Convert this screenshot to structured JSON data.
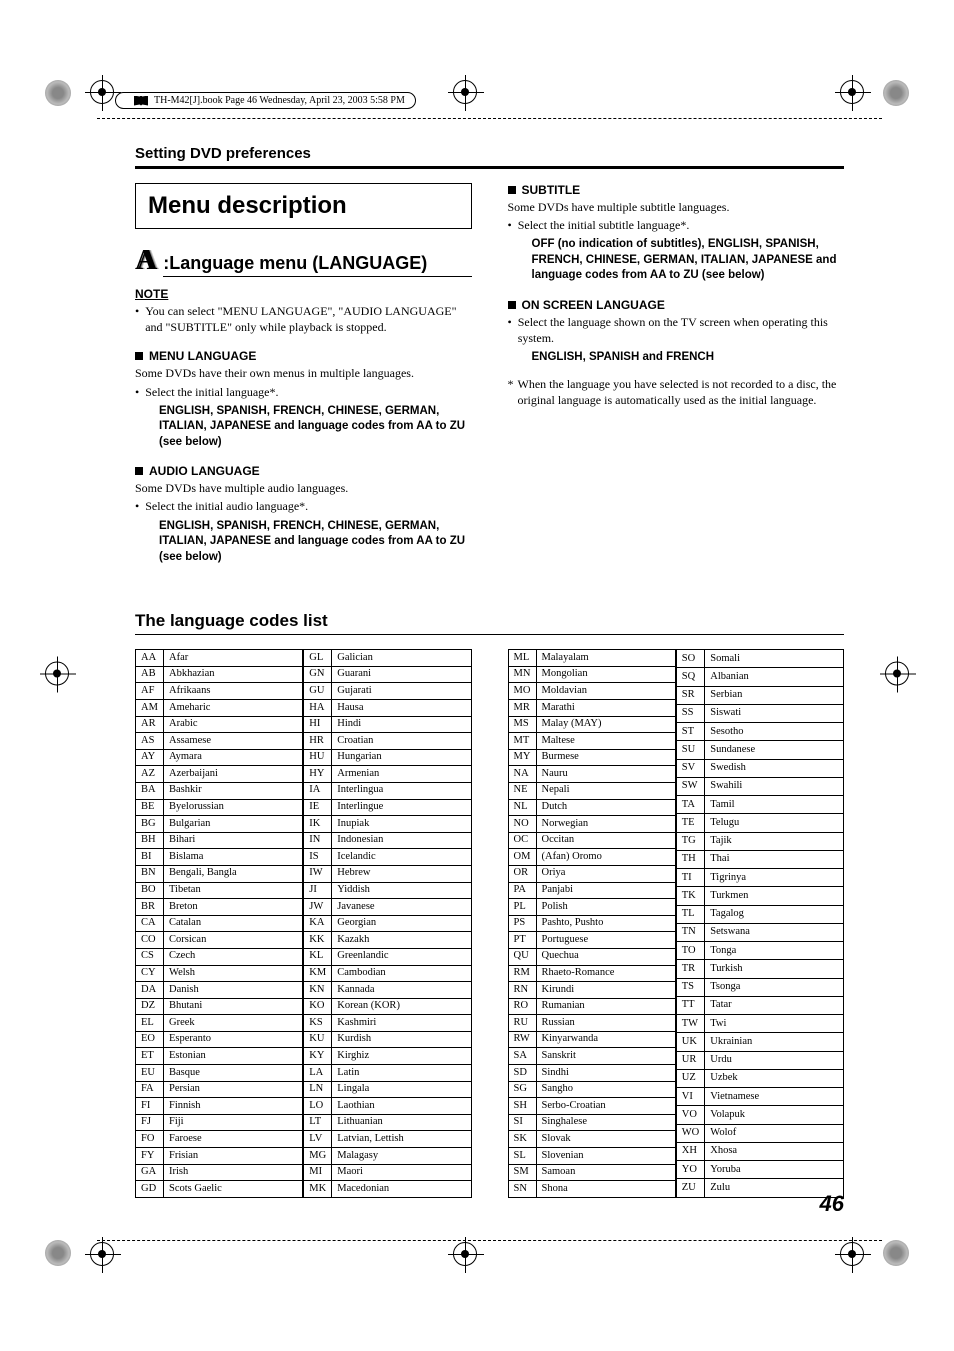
{
  "book_header": "TH-M42[J].book  Page 46  Wednesday, April 23, 2003  5:58 PM",
  "section_header": "Setting DVD preferences",
  "menu_title": "Menu description",
  "language_icon_prefix": ":",
  "language_menu_heading": "Language menu (LANGUAGE)",
  "note_label": "NOTE",
  "note_text": "You can select \"MENU LANGUAGE\", \"AUDIO LANGUAGE\" and \"SUBTITLE\" only while playback is stopped.",
  "sections": {
    "menu_language": {
      "title": "MENU LANGUAGE",
      "intro": "Some DVDs have their own menus in multiple languages.",
      "bullet": "Select the initial language*.",
      "options": "ENGLISH, SPANISH, FRENCH, CHINESE, GERMAN, ITALIAN, JAPANESE and language codes from AA to ZU (see below)"
    },
    "audio_language": {
      "title": "AUDIO LANGUAGE",
      "intro": "Some DVDs have multiple audio languages.",
      "bullet": "Select the initial audio language*.",
      "options": "ENGLISH, SPANISH, FRENCH, CHINESE, GERMAN, ITALIAN, JAPANESE and language codes from AA to ZU (see below)"
    },
    "subtitle": {
      "title": "SUBTITLE",
      "intro": "Some DVDs have multiple subtitle languages.",
      "bullet": "Select the initial subtitle language*.",
      "options": "OFF (no indication of subtitles), ENGLISH, SPANISH, FRENCH, CHINESE, GERMAN, ITALIAN, JAPANESE and language codes from AA to ZU (see below)"
    },
    "on_screen": {
      "title": "ON SCREEN LANGUAGE",
      "bullet": "Select the language shown on the TV screen when operating this system.",
      "options": "ENGLISH, SPANISH and FRENCH"
    }
  },
  "footnote": "When the language you have selected is not recorded to a disc, the original language is automatically used as the initial language.",
  "table_heading": "The language codes list",
  "codes": {
    "col1a": [
      [
        "AA",
        "Afar"
      ],
      [
        "AB",
        "Abkhazian"
      ],
      [
        "AF",
        "Afrikaans"
      ],
      [
        "AM",
        "Ameharic"
      ],
      [
        "AR",
        "Arabic"
      ],
      [
        "AS",
        "Assamese"
      ],
      [
        "AY",
        "Aymara"
      ],
      [
        "AZ",
        "Azerbaijani"
      ],
      [
        "BA",
        "Bashkir"
      ],
      [
        "BE",
        "Byelorussian"
      ],
      [
        "BG",
        "Bulgarian"
      ],
      [
        "BH",
        "Bihari"
      ],
      [
        "BI",
        "Bislama"
      ],
      [
        "BN",
        "Bengali, Bangla"
      ],
      [
        "BO",
        "Tibetan"
      ],
      [
        "BR",
        "Breton"
      ],
      [
        "CA",
        "Catalan"
      ],
      [
        "CO",
        "Corsican"
      ],
      [
        "CS",
        "Czech"
      ],
      [
        "CY",
        "Welsh"
      ],
      [
        "DA",
        "Danish"
      ],
      [
        "DZ",
        "Bhutani"
      ],
      [
        "EL",
        "Greek"
      ],
      [
        "EO",
        "Esperanto"
      ],
      [
        "ET",
        "Estonian"
      ],
      [
        "EU",
        "Basque"
      ],
      [
        "FA",
        "Persian"
      ],
      [
        "FI",
        "Finnish"
      ],
      [
        "FJ",
        "Fiji"
      ],
      [
        "FO",
        "Faroese"
      ],
      [
        "FY",
        "Frisian"
      ],
      [
        "GA",
        "Irish"
      ],
      [
        "GD",
        "Scots Gaelic"
      ]
    ],
    "col1b": [
      [
        "GL",
        "Galician"
      ],
      [
        "GN",
        "Guarani"
      ],
      [
        "GU",
        "Gujarati"
      ],
      [
        "HA",
        "Hausa"
      ],
      [
        "HI",
        "Hindi"
      ],
      [
        "HR",
        "Croatian"
      ],
      [
        "HU",
        "Hungarian"
      ],
      [
        "HY",
        "Armenian"
      ],
      [
        "IA",
        "Interlingua"
      ],
      [
        "IE",
        "Interlingue"
      ],
      [
        "IK",
        "Inupiak"
      ],
      [
        "IN",
        "Indonesian"
      ],
      [
        "IS",
        "Icelandic"
      ],
      [
        "IW",
        "Hebrew"
      ],
      [
        "JI",
        "Yiddish"
      ],
      [
        "JW",
        "Javanese"
      ],
      [
        "KA",
        "Georgian"
      ],
      [
        "KK",
        "Kazakh"
      ],
      [
        "KL",
        "Greenlandic"
      ],
      [
        "KM",
        "Cambodian"
      ],
      [
        "KN",
        "Kannada"
      ],
      [
        "KO",
        "Korean (KOR)"
      ],
      [
        "KS",
        "Kashmiri"
      ],
      [
        "KU",
        "Kurdish"
      ],
      [
        "KY",
        "Kirghiz"
      ],
      [
        "LA",
        "Latin"
      ],
      [
        "LN",
        "Lingala"
      ],
      [
        "LO",
        "Laothian"
      ],
      [
        "LT",
        "Lithuanian"
      ],
      [
        "LV",
        "Latvian, Lettish"
      ],
      [
        "MG",
        "Malagasy"
      ],
      [
        "MI",
        "Maori"
      ],
      [
        "MK",
        "Macedonian"
      ]
    ],
    "col2a": [
      [
        "ML",
        "Malayalam"
      ],
      [
        "MN",
        "Mongolian"
      ],
      [
        "MO",
        "Moldavian"
      ],
      [
        "MR",
        "Marathi"
      ],
      [
        "MS",
        "Malay (MAY)"
      ],
      [
        "MT",
        "Maltese"
      ],
      [
        "MY",
        "Burmese"
      ],
      [
        "NA",
        "Nauru"
      ],
      [
        "NE",
        "Nepali"
      ],
      [
        "NL",
        "Dutch"
      ],
      [
        "NO",
        "Norwegian"
      ],
      [
        "OC",
        "Occitan"
      ],
      [
        "OM",
        "(Afan) Oromo"
      ],
      [
        "OR",
        "Oriya"
      ],
      [
        "PA",
        "Panjabi"
      ],
      [
        "PL",
        "Polish"
      ],
      [
        "PS",
        "Pashto, Pushto"
      ],
      [
        "PT",
        "Portuguese"
      ],
      [
        "QU",
        "Quechua"
      ],
      [
        "RM",
        "Rhaeto-Romance"
      ],
      [
        "RN",
        "Kirundi"
      ],
      [
        "RO",
        "Rumanian"
      ],
      [
        "RU",
        "Russian"
      ],
      [
        "RW",
        "Kinyarwanda"
      ],
      [
        "SA",
        "Sanskrit"
      ],
      [
        "SD",
        "Sindhi"
      ],
      [
        "SG",
        "Sangho"
      ],
      [
        "SH",
        "Serbo-Croatian"
      ],
      [
        "SI",
        "Singhalese"
      ],
      [
        "SK",
        "Slovak"
      ],
      [
        "SL",
        "Slovenian"
      ],
      [
        "SM",
        "Samoan"
      ],
      [
        "SN",
        "Shona"
      ]
    ],
    "col2b": [
      [
        "SO",
        "Somali"
      ],
      [
        "SQ",
        "Albanian"
      ],
      [
        "SR",
        "Serbian"
      ],
      [
        "SS",
        "Siswati"
      ],
      [
        "ST",
        "Sesotho"
      ],
      [
        "SU",
        "Sundanese"
      ],
      [
        "SV",
        "Swedish"
      ],
      [
        "SW",
        "Swahili"
      ],
      [
        "TA",
        "Tamil"
      ],
      [
        "TE",
        "Telugu"
      ],
      [
        "TG",
        "Tajik"
      ],
      [
        "TH",
        "Thai"
      ],
      [
        "TI",
        "Tigrinya"
      ],
      [
        "TK",
        "Turkmen"
      ],
      [
        "TL",
        "Tagalog"
      ],
      [
        "TN",
        "Setswana"
      ],
      [
        "TO",
        "Tonga"
      ],
      [
        "TR",
        "Turkish"
      ],
      [
        "TS",
        "Tsonga"
      ],
      [
        "TT",
        "Tatar"
      ],
      [
        "TW",
        "Twi"
      ],
      [
        "UK",
        "Ukrainian"
      ],
      [
        "UR",
        "Urdu"
      ],
      [
        "UZ",
        "Uzbek"
      ],
      [
        "VI",
        "Vietnamese"
      ],
      [
        "VO",
        "Volapuk"
      ],
      [
        "WO",
        "Wolof"
      ],
      [
        "XH",
        "Xhosa"
      ],
      [
        "YO",
        "Yoruba"
      ],
      [
        "ZU",
        "Zulu"
      ]
    ]
  },
  "page_number": "46"
}
